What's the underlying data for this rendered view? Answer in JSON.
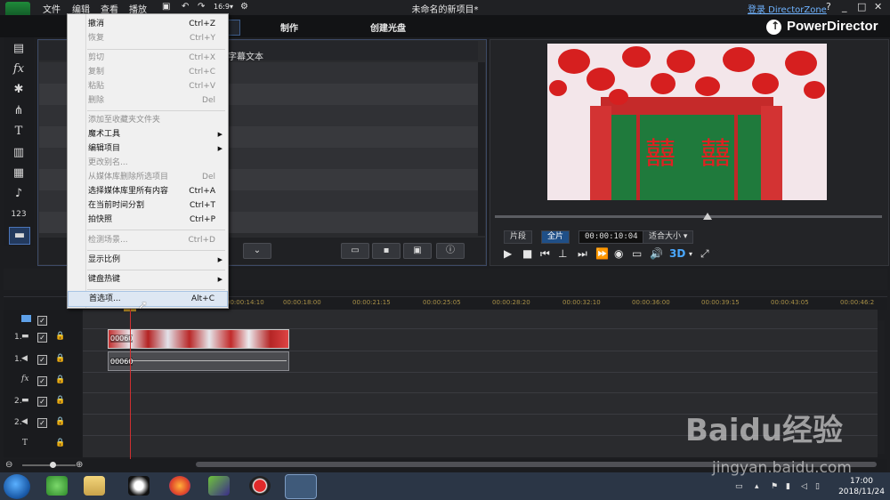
{
  "titlebar": {
    "menus": [
      "文件",
      "编辑",
      "查看",
      "播放"
    ],
    "title": "未命名的新项目*",
    "login": "登录 DirectorZone",
    "buttons": [
      "?",
      "_",
      "□",
      "✕"
    ]
  },
  "mode_tabs": [
    "制作",
    "创建光盘"
  ],
  "brand": "PowerDirector",
  "library": {
    "caption_suffix": "字幕文本"
  },
  "edit_menu": {
    "items": [
      {
        "label": "撤消",
        "shortcut": "Ctrl+Z",
        "enabled": true
      },
      {
        "label": "恢复",
        "shortcut": "Ctrl+Y",
        "enabled": false
      },
      {
        "label": "剪切",
        "shortcut": "Ctrl+X",
        "enabled": false
      },
      {
        "label": "复制",
        "shortcut": "Ctrl+C",
        "enabled": false
      },
      {
        "label": "粘贴",
        "shortcut": "Ctrl+V",
        "enabled": false
      },
      {
        "label": "删除",
        "shortcut": "Del",
        "enabled": false
      },
      {
        "label": "添加至收藏夹文件夹",
        "shortcut": "",
        "enabled": false
      },
      {
        "label": "魔术工具",
        "shortcut": "",
        "enabled": true,
        "submenu": true
      },
      {
        "label": "编辑项目",
        "shortcut": "",
        "enabled": true,
        "submenu": true
      },
      {
        "label": "更改别名...",
        "shortcut": "",
        "enabled": false
      },
      {
        "label": "从媒体库删除所选项目",
        "shortcut": "Del",
        "enabled": false
      },
      {
        "label": "选择媒体库里所有内容",
        "shortcut": "Ctrl+A",
        "enabled": true
      },
      {
        "label": "在当前时间分割",
        "shortcut": "Ctrl+T",
        "enabled": true
      },
      {
        "label": "拍快照",
        "shortcut": "Ctrl+P",
        "enabled": true
      },
      {
        "label": "检测场景...",
        "shortcut": "Ctrl+D",
        "enabled": false
      },
      {
        "label": "显示比例",
        "shortcut": "",
        "enabled": true,
        "submenu": true
      },
      {
        "label": "键盘热键",
        "shortcut": "",
        "enabled": true,
        "submenu": true
      },
      {
        "label": "首选项...",
        "shortcut": "Alt+C",
        "enabled": true,
        "highlighted": true
      }
    ]
  },
  "preview": {
    "mode_clip": "片段",
    "mode_movie": "全片",
    "timecode": "00:00:10:04",
    "zoom": "适合大小",
    "seek_fraction": 0.55
  },
  "timeline": {
    "ruler": [
      "00:00:14:10",
      "00:00:18:00",
      "00:00:21:15",
      "00:00:25:05",
      "00:00:28:20",
      "00:00:32:10",
      "00:00:36:00",
      "00:00:39:15",
      "00:00:43:05",
      "00:00:46:2"
    ],
    "tracks": [
      {
        "label": "",
        "kind": "master"
      },
      {
        "label": "1.",
        "kind": "video"
      },
      {
        "label": "1.",
        "kind": "audio"
      },
      {
        "label": "fx",
        "kind": "fx"
      },
      {
        "label": "2.",
        "kind": "video"
      },
      {
        "label": "2.",
        "kind": "audio"
      },
      {
        "label": "T",
        "kind": "title"
      }
    ],
    "clip_label": "00060"
  },
  "taskbar": {
    "time": "17:00",
    "date": "2018/11/24"
  },
  "watermark": {
    "main": "Baidu经验",
    "sub": "jingyan.baidu.com"
  }
}
